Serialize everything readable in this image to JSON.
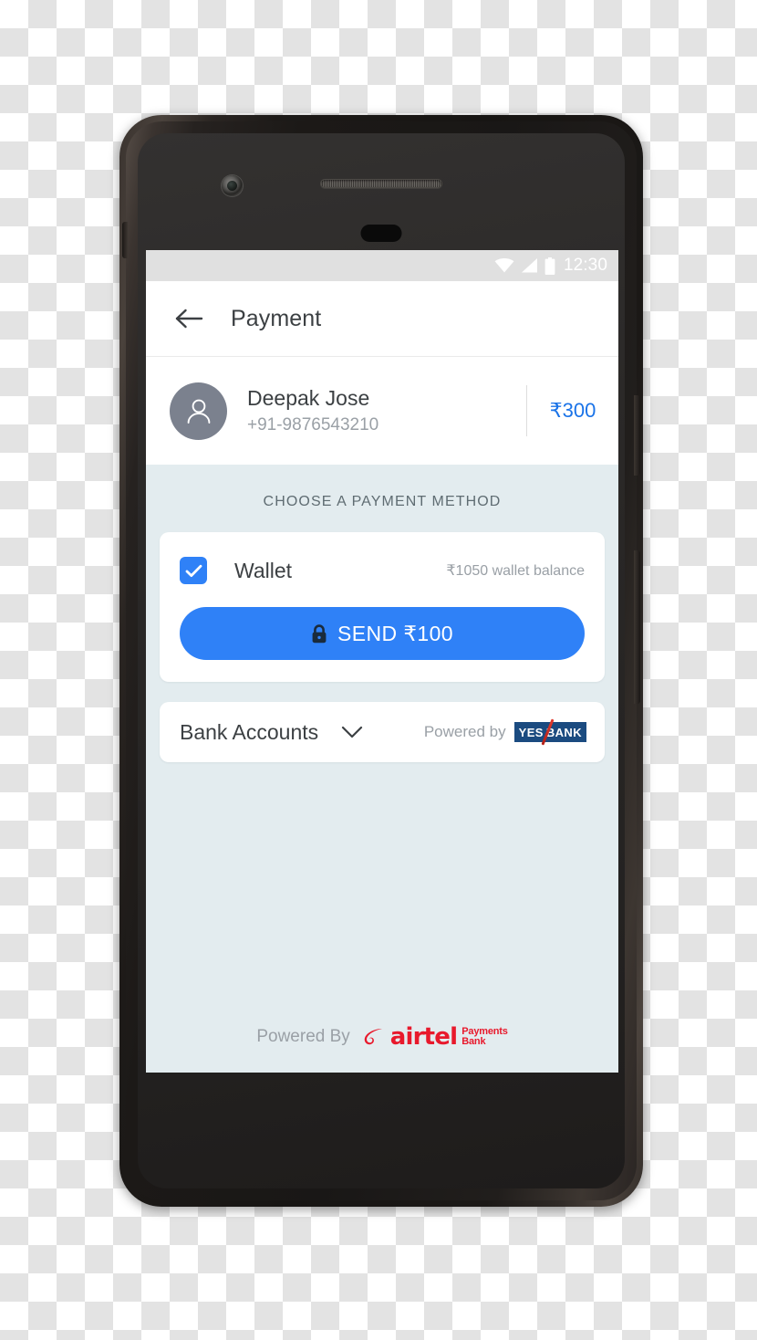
{
  "device": {
    "name": "android-smartphone",
    "hardware": {
      "camera": "front-camera",
      "earpiece": "earpiece-speaker",
      "sensor": "proximity-sensor",
      "power_button": "power-button",
      "volume_button": "volume-button",
      "sim_tray": "sim-tray"
    }
  },
  "status_bar": {
    "time": "12:30",
    "icons": [
      "wifi-icon",
      "signal-icon",
      "battery-icon"
    ],
    "background": "#e0e0e0"
  },
  "app_bar": {
    "back_icon": "back-arrow-icon",
    "title": "Payment"
  },
  "recipient": {
    "avatar_icon": "person-avatar-icon",
    "name": "Deepak Jose",
    "phone": "+91-9876543210",
    "amount": "₹300",
    "amount_color": "#1a73e8"
  },
  "payment": {
    "section_title": "CHOOSE A PAYMENT METHOD",
    "wallet": {
      "checked": true,
      "checkbox_icon": "checkbox-checked-icon",
      "label": "Wallet",
      "balance": "₹1050 wallet balance"
    },
    "send_button": {
      "lock_icon": "lock-icon",
      "label": "SEND ₹100",
      "color": "#2f81f7"
    }
  },
  "bank_accounts": {
    "label": "Bank Accounts",
    "chevron_icon": "chevron-down-icon",
    "powered_by_text": "Powered by",
    "logo": {
      "name": "yes-bank-logo",
      "word1": "YES",
      "word2": "BANK",
      "background": "#1b4b80",
      "slash_color": "#c9261a"
    }
  },
  "footer": {
    "text": "Powered By",
    "logo": {
      "name": "airtel-payments-bank-logo",
      "brand": "airtel",
      "line1": "Payments",
      "line2": "Bank",
      "color": "#e8192c"
    }
  },
  "theme": {
    "screen_background": "#e3ecef",
    "card_background": "#ffffff",
    "accent": "#2f81f7",
    "text_primary": "#3c4043",
    "text_secondary": "#9aa0a6"
  }
}
